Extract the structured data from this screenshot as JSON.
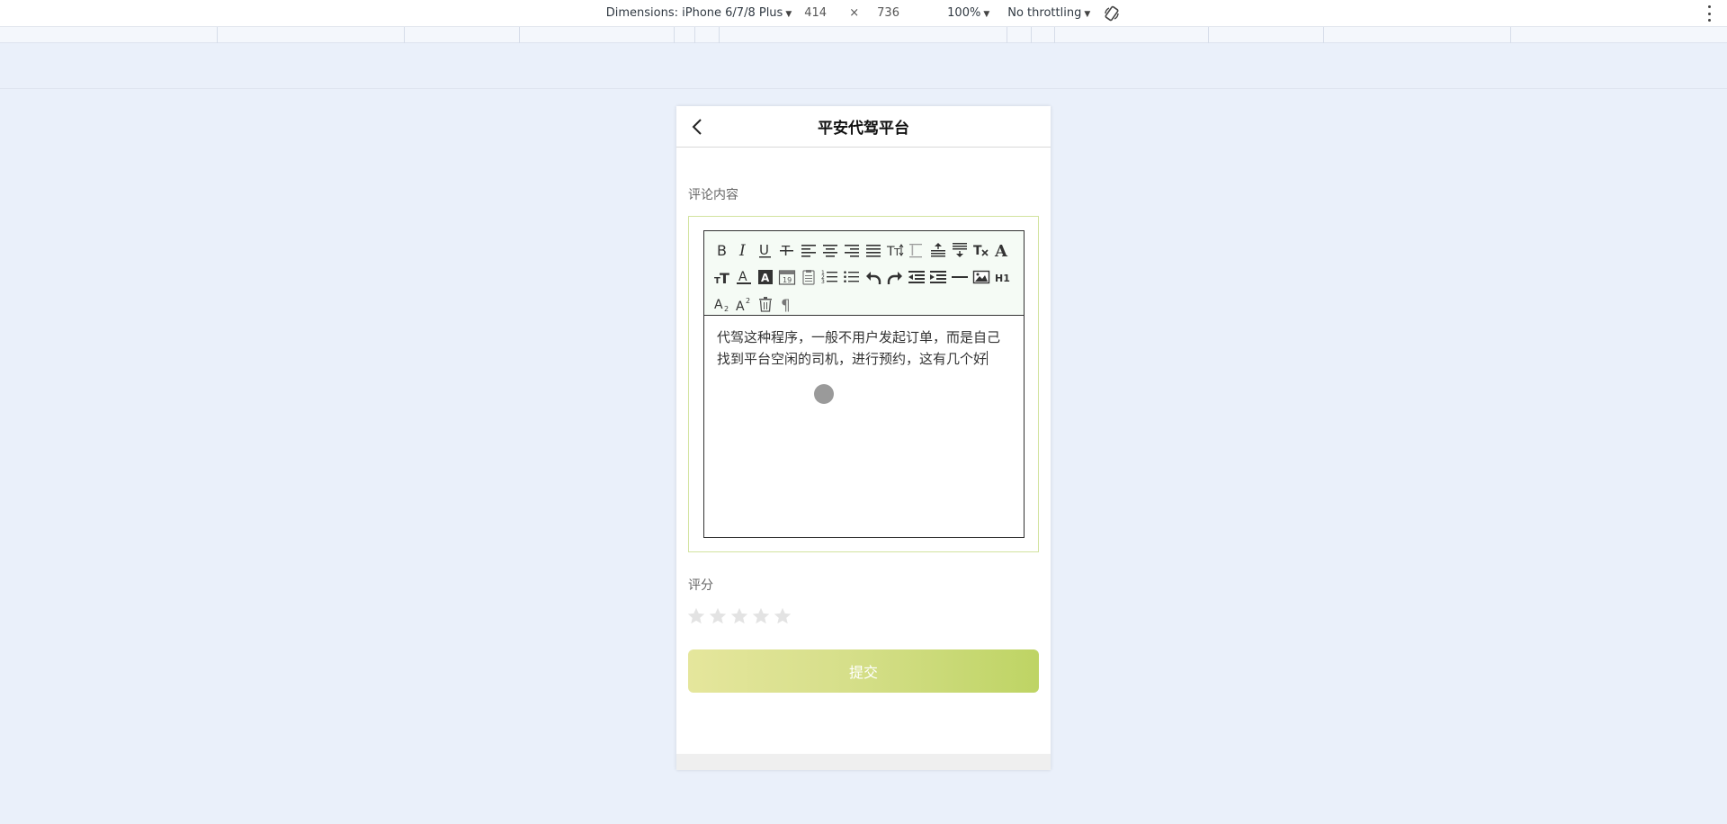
{
  "devtools": {
    "dimensions_label": "Dimensions: iPhone 6/7/8 Plus",
    "width_value": "414",
    "times": "×",
    "height_value": "736",
    "zoom": "100%",
    "throttling": "No throttling"
  },
  "page": {
    "title": "平安代驾平台",
    "comment_label": "评论内容",
    "comment_text": "代驾这种程序，一般不用户发起订单，而是自己找到平台空闲的司机，进行预约，这有几个好",
    "rating_label": "评分",
    "rating_value": 0,
    "rating_max": 5,
    "submit_label": "提交"
  },
  "editor": {
    "toolbar_row1": [
      "bold-icon",
      "italic-icon",
      "underline-icon",
      "strikethrough-icon",
      "align-left-icon",
      "align-center-icon",
      "align-right-icon",
      "align-justify-icon",
      "font-size-icon",
      "line-height-icon",
      "paragraph-spacing-top-icon",
      "paragraph-spacing-bottom-icon",
      "clear-format-icon",
      "font-family-icon"
    ],
    "toolbar_row2": [
      "text-size-icon",
      "font-color-icon",
      "background-color-icon",
      "date-icon",
      "paste-plain-icon",
      "ordered-list-icon",
      "unordered-list-icon",
      "undo-icon",
      "redo-icon",
      "outdent-icon",
      "indent-icon",
      "horizontal-rule-icon",
      "image-icon",
      "heading-icon"
    ],
    "toolbar_row3": [
      "subscript-icon",
      "superscript-icon",
      "delete-icon",
      "paragraph-icon"
    ],
    "heading_glyph": "H1"
  },
  "colors": {
    "star_empty": "#e3e3e3",
    "editor_border": "#d2e3a0",
    "submit_start": "#e5e69c",
    "submit_end": "#bed464"
  }
}
